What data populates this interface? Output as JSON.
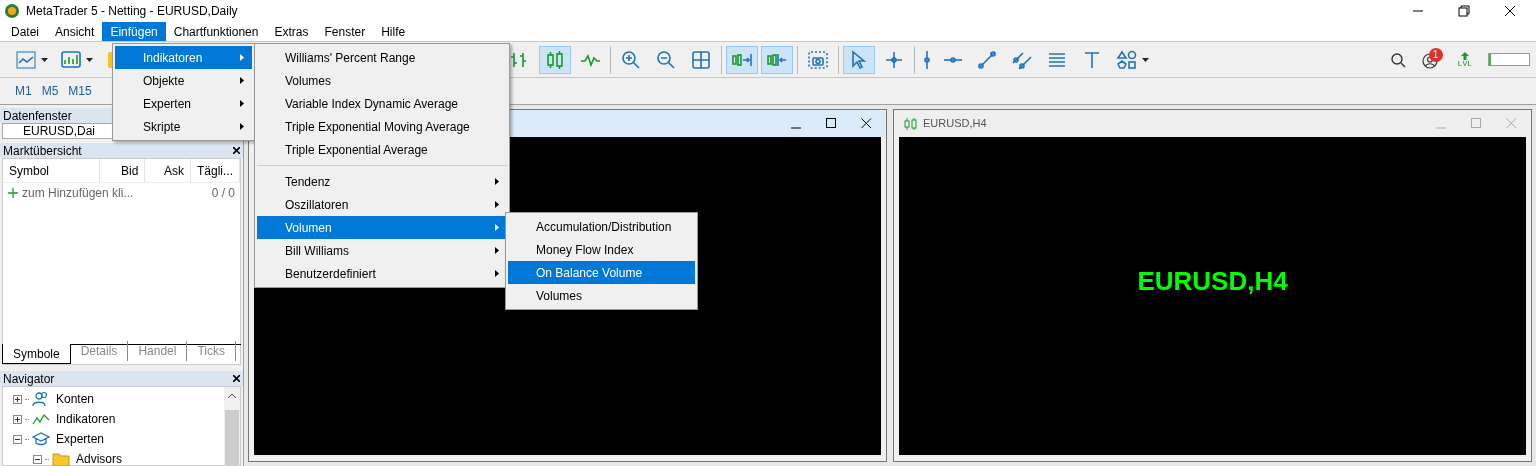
{
  "window": {
    "title": "MetaTrader 5 - Netting - EURUSD,Daily"
  },
  "menu_bar": [
    {
      "label": "Datei",
      "selected": false
    },
    {
      "label": "Ansicht",
      "selected": false
    },
    {
      "label": "Einfügen",
      "selected": true
    },
    {
      "label": "Chartfunktionen",
      "selected": false
    },
    {
      "label": "Extras",
      "selected": false
    },
    {
      "label": "Fenster",
      "selected": false
    },
    {
      "label": "Hilfe",
      "selected": false
    }
  ],
  "toolbar": {
    "left": [
      {
        "kind": "line-chart",
        "selected": false,
        "dropdown": true
      },
      {
        "kind": "chart-window",
        "selected": false,
        "dropdown": true
      },
      {
        "kind": "dollar",
        "selected": false,
        "dropdown": false
      }
    ],
    "groups": [
      [
        {
          "kind": "bars",
          "selected": false,
          "dropdown": false
        },
        {
          "kind": "candles",
          "selected": true,
          "dropdown": false
        },
        {
          "kind": "line",
          "selected": false,
          "dropdown": false
        }
      ],
      [
        {
          "kind": "zoom-in",
          "selected": false,
          "dropdown": false
        },
        {
          "kind": "zoom-out",
          "selected": false,
          "dropdown": false
        },
        {
          "kind": "grid",
          "selected": false,
          "dropdown": false
        }
      ],
      [
        {
          "kind": "autoscroll",
          "selected": true,
          "dropdown": false
        },
        {
          "kind": "chart-shift",
          "selected": true,
          "dropdown": false
        }
      ],
      [
        {
          "kind": "screenshot",
          "selected": false,
          "dropdown": false
        }
      ],
      [
        {
          "kind": "cursor",
          "selected": true,
          "dropdown": false
        },
        {
          "kind": "crosshair",
          "selected": false,
          "dropdown": false
        }
      ],
      [
        {
          "kind": "vline",
          "selected": false,
          "dropdown": false
        },
        {
          "kind": "hline",
          "selected": false,
          "dropdown": false
        },
        {
          "kind": "trendline",
          "selected": false,
          "dropdown": false
        },
        {
          "kind": "channel",
          "selected": false,
          "dropdown": false
        },
        {
          "kind": "lines",
          "selected": false,
          "dropdown": false
        },
        {
          "kind": "text",
          "selected": false,
          "dropdown": false
        },
        {
          "kind": "shapes",
          "selected": false,
          "dropdown": true
        }
      ]
    ]
  },
  "status": {
    "badge": "1",
    "lvl_label": "LVL",
    "level": 0.06
  },
  "timeframes": [
    "M1",
    "M5",
    "M15"
  ],
  "data_window": {
    "title": "Datenfenster",
    "value": "EURUSD,Dai"
  },
  "market_watch": {
    "title": "Marktübersicht",
    "columns": [
      "Symbol",
      "Bid",
      "Ask",
      "Tägli..."
    ],
    "add_row": {
      "label": "zum Hinzufügen kli...",
      "count": "0 / 0"
    },
    "tabs": [
      {
        "label": "Symbole",
        "selected": true
      },
      {
        "label": "Details",
        "selected": false
      },
      {
        "label": "Handel",
        "selected": false
      },
      {
        "label": "Ticks",
        "selected": false
      }
    ]
  },
  "navigator": {
    "title": "Navigator",
    "tree": [
      {
        "label": "Konten",
        "kind": "accounts",
        "expanded": false
      },
      {
        "label": "Indikatoren",
        "kind": "indicators",
        "expanded": false
      },
      {
        "label": "Experten",
        "kind": "experts",
        "expanded": true,
        "children": [
          {
            "label": "Advisors",
            "kind": "folder",
            "expanded": true
          }
        ]
      }
    ]
  },
  "charts": [
    {
      "active": true
    },
    {
      "active": false,
      "title": "EURUSD,H4",
      "label": "EURUSD,H4"
    }
  ],
  "insert_menu": [
    {
      "label": "Indikatoren",
      "selected": true
    },
    {
      "label": "Objekte",
      "selected": false
    },
    {
      "label": "Experten",
      "selected": false
    },
    {
      "label": "Skripte",
      "selected": false
    }
  ],
  "indicators_menu": [
    {
      "kind": "item",
      "label": "Williams' Percent Range",
      "selected": false
    },
    {
      "kind": "item",
      "label": "Volumes",
      "selected": false
    },
    {
      "kind": "item",
      "label": "Variable Index Dynamic Average",
      "selected": false
    },
    {
      "kind": "item",
      "label": "Triple Exponential Moving Average",
      "selected": false
    },
    {
      "kind": "item",
      "label": "Triple Exponential Average",
      "selected": false
    },
    {
      "kind": "separator"
    },
    {
      "kind": "submenu",
      "label": "Tendenz",
      "selected": false
    },
    {
      "kind": "submenu",
      "label": "Oszillatoren",
      "selected": false
    },
    {
      "kind": "submenu",
      "label": "Volumen",
      "selected": true
    },
    {
      "kind": "submenu",
      "label": "Bill Williams",
      "selected": false
    },
    {
      "kind": "submenu",
      "label": "Benutzerdefiniert",
      "selected": false
    }
  ],
  "volume_menu": [
    {
      "label": "Accumulation/Distribution",
      "selected": false
    },
    {
      "label": "Money Flow Index",
      "selected": false
    },
    {
      "label": "On Balance Volume",
      "selected": true
    },
    {
      "label": "Volumes",
      "selected": false
    }
  ]
}
